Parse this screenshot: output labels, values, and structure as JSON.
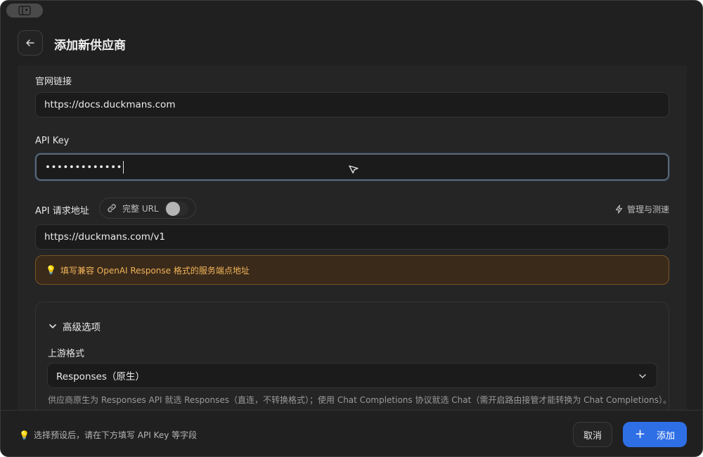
{
  "header": {
    "title": "添加新供应商"
  },
  "form": {
    "website": {
      "label": "官网链接",
      "value": "https://docs.duckmans.com"
    },
    "api_key": {
      "label": "API Key",
      "value": "•••••••••••••"
    },
    "endpoint": {
      "label": "API 请求地址",
      "full_url_label": "完整 URL",
      "full_url_enabled": false,
      "manage_label": "管理与测速",
      "value": "https://duckmans.com/v1",
      "hint": "填写兼容 OpenAI Response 格式的服务端点地址"
    },
    "advanced": {
      "title": "高级选项",
      "expanded": true,
      "upstream_label": "上游格式",
      "upstream_value": "Responses（原生）",
      "description": "供应商原生为 Responses API 就选 Responses（直连，不转换格式）；使用 Chat Completions 协议就选 Chat（需开启路由接管才能转换为 Chat Completions）。"
    }
  },
  "footer": {
    "hint": "选择预设后，请在下方填写 API Key 等字段",
    "cancel_label": "取消",
    "add_label": "添加"
  },
  "colors": {
    "background": "#202020",
    "accent": "#2f6fe6",
    "warning_text": "#f2b45a",
    "warning_border": "#7a5424"
  }
}
